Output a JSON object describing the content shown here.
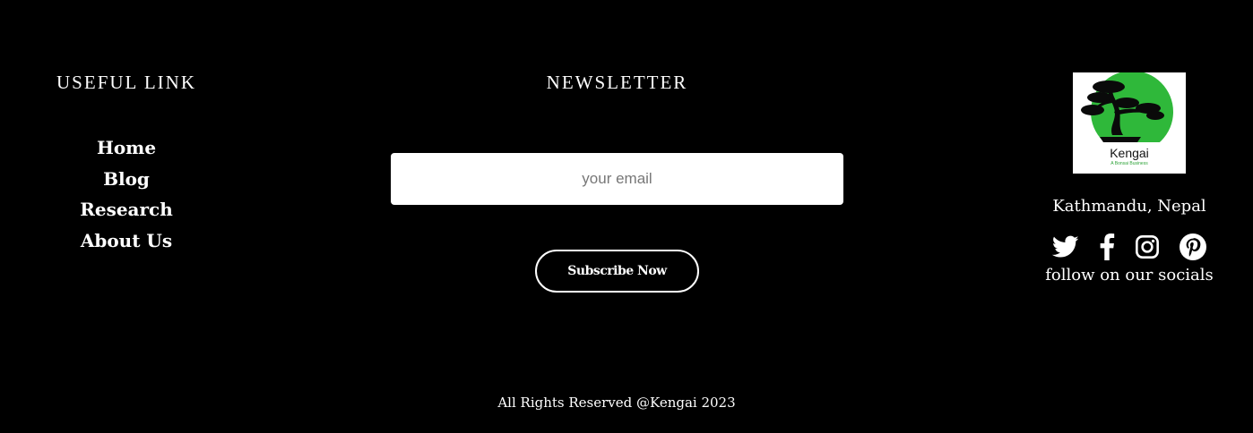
{
  "useful_links": {
    "title": "USEFUL LINK",
    "items": [
      {
        "label": "Home"
      },
      {
        "label": "Blog"
      },
      {
        "label": "Research"
      },
      {
        "label": "About Us"
      }
    ]
  },
  "newsletter": {
    "title": "NEWSLETTER",
    "email_placeholder": "your email",
    "email_value": "",
    "subscribe_label": "Subscribe Now"
  },
  "brand": {
    "logo_name": "Kengai",
    "logo_tagline": "A Bonsai Business",
    "logo_icon": "bonsai-tree-on-green-circle",
    "location": "Kathmandu, Nepal",
    "socials": [
      {
        "name": "twitter-icon"
      },
      {
        "name": "facebook-icon"
      },
      {
        "name": "instagram-icon"
      },
      {
        "name": "pinterest-icon"
      }
    ],
    "follow_text": "follow on our socials"
  },
  "footer": {
    "copyright": "All Rights Reserved @Kengai 2023"
  },
  "colors": {
    "background": "#000000",
    "text": "#ffffff",
    "logo_green": "#2fb83a"
  }
}
